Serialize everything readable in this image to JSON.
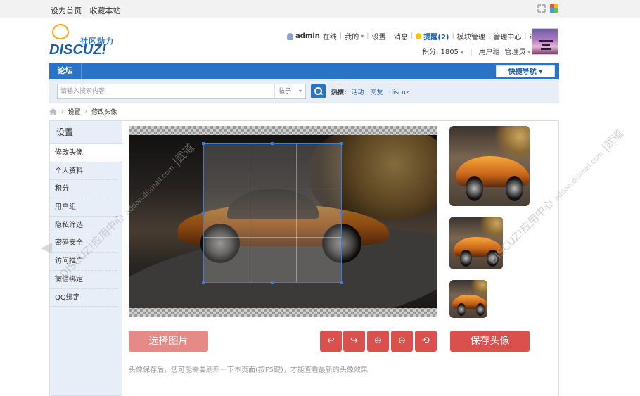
{
  "topbar": {
    "set_home": "设为首页",
    "bookmark": "收藏本站"
  },
  "logo": {
    "slogan": "社区动力",
    "brand": "DISCUZ!"
  },
  "user": {
    "name": "admin",
    "status": "在线",
    "my": "我的",
    "settings": "设置",
    "messages": "消息",
    "remind": "提醒(2)",
    "module_manage": "模块管理",
    "admin_center": "管理中心",
    "logout": "退出",
    "points": "积分: 1805",
    "user_group": "用户组: 管理员"
  },
  "nav": {
    "forum": "论坛",
    "quick_nav": "快捷导航 ▾"
  },
  "search": {
    "placeholder": "请输入搜索内容",
    "scope": "帖子",
    "hot_label": "热搜:",
    "hot": [
      "活动",
      "交友",
      "discuz"
    ]
  },
  "breadcrumb": {
    "items": [
      "设置",
      "修改头像"
    ]
  },
  "sidebar": {
    "title": "设置",
    "items": [
      "修改头像",
      "个人资料",
      "积分",
      "用户组",
      "隐私筛选",
      "密码安全",
      "访问推广",
      "微信绑定",
      "QQ绑定"
    ],
    "active_index": 0
  },
  "editor": {
    "choose_image": "选择图片",
    "save_avatar": "保存头像",
    "tools": [
      {
        "name": "rotate-left",
        "glyph": "↩"
      },
      {
        "name": "rotate-right",
        "glyph": "↪"
      },
      {
        "name": "zoom-in",
        "glyph": "⊕"
      },
      {
        "name": "zoom-out",
        "glyph": "⊖"
      },
      {
        "name": "reset",
        "glyph": "⟲"
      }
    ],
    "hint": "头像保存后，您可能需要刷新一下本页面(按F5键)，才能查看最新的头像效果"
  },
  "watermarks": {
    "left_main": "DISCUZ!应用中心",
    "left_sub": "addon.dismall.com",
    "left_tail": "|武道",
    "right_main": "DISCUZ!应用中心",
    "right_sub": "addon.dismall.com",
    "right_tail": "|武道"
  },
  "colors": {
    "primary": "#2b73c4",
    "danger": "#d9504c",
    "danger_light": "#e58a86",
    "sidebar_bg": "#e8eef7"
  }
}
